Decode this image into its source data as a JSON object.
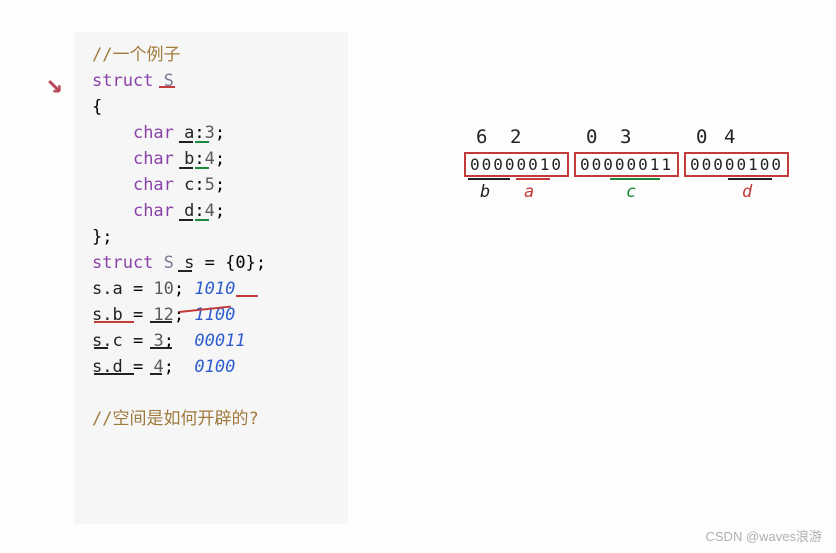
{
  "code": {
    "comment_top": "//一个例子",
    "struct_keyword": "struct",
    "struct_name": "S",
    "brace_open": "{",
    "fields": [
      {
        "type": "char",
        "name": "a",
        "bits": "3"
      },
      {
        "type": "char",
        "name": "b",
        "bits": "4"
      },
      {
        "type": "char",
        "name": "c",
        "bits": "5"
      },
      {
        "type": "char",
        "name": "d",
        "bits": "4"
      }
    ],
    "brace_close": "};",
    "decl_line": {
      "struct_keyword": "struct",
      "struct_name": "S",
      "varname": "s",
      "init": "= {0};"
    },
    "assignments": [
      {
        "lhs": "s.a",
        "val": "10",
        "binary": "1010"
      },
      {
        "lhs": "s.b",
        "val": "12",
        "binary": "1100"
      },
      {
        "lhs": "s.c",
        "val": "3",
        "binary": "00011"
      },
      {
        "lhs": "s.d",
        "val": "4",
        "binary": "0100"
      }
    ],
    "comment_bottom": "//空间是如何开辟的?"
  },
  "diagram": {
    "bytes": [
      {
        "bits": "00000010",
        "top_left": "6",
        "top_right": "2",
        "label_left": "b",
        "label_right": "a"
      },
      {
        "bits": "00000011",
        "top_left": "0",
        "top_right": "3",
        "label_center": "c"
      },
      {
        "bits": "00000100",
        "top_left": "0",
        "top_right": "4",
        "label_center": "d"
      }
    ]
  },
  "watermark": "CSDN @waves浪游"
}
